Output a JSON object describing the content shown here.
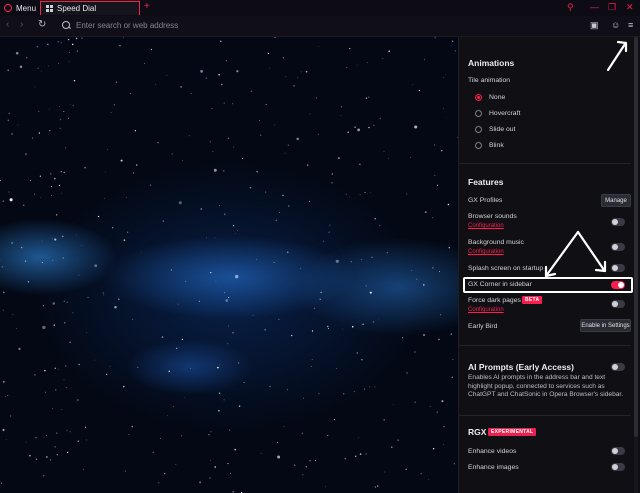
{
  "tabbar": {
    "menu_label": "Menu",
    "tab_title": "Speed Dial",
    "new_tab": "+"
  },
  "addressbar": {
    "placeholder": "Enter search or web address"
  },
  "animations": {
    "title": "Animations",
    "tile_animation_label": "Tile animation",
    "options": [
      "None",
      "Hovercraft",
      "Slide out",
      "Blink"
    ],
    "selected": "None"
  },
  "features": {
    "title": "Features",
    "gx_profiles": "GX Profiles",
    "manage_button": "Manage",
    "browser_sounds": "Browser sounds",
    "browser_sounds_config": "Configuration",
    "background_music": "Background music",
    "background_music_config": "Configuration",
    "splash_screen": "Splash screen on startup",
    "gx_corner": "GX Corner in sidebar",
    "force_dark": "Force dark pages",
    "force_dark_badge": "BETA",
    "force_dark_config": "Configuration",
    "early_bird": "Early Bird",
    "enable_in_settings": "Enable in Settings"
  },
  "ai_prompts": {
    "title": "AI Prompts (Early Access)",
    "description": "Enables AI prompts in the address bar and text highlight popup, connected to services such as ChatGPT and ChatSonic in Opera Browser's sidebar."
  },
  "rgx": {
    "title": "RGX",
    "badge": "EXPERIMENTAL",
    "enhance_videos": "Enhance videos",
    "enhance_images": "Enhance images"
  },
  "colors": {
    "accent": "#fa1e4e",
    "panel_bg": "#101014",
    "annotation": "#ffffff"
  }
}
